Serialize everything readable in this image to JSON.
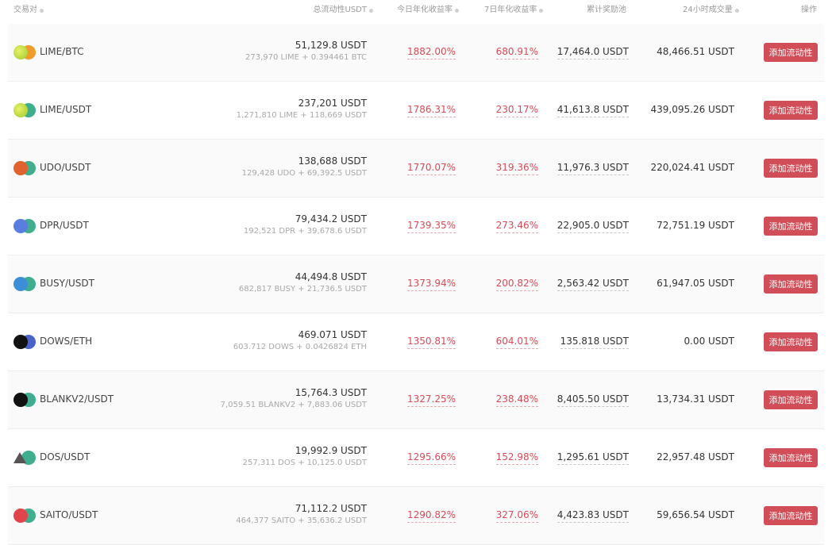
{
  "header": {
    "pair": "交易对",
    "liquidity": "总流动性USDT",
    "today_apr": "今日年化收益率",
    "apr_7d": "7日年化收益率",
    "reward_pool": "累计奖励池",
    "volume_24h": "24小时成交量",
    "action": "操作"
  },
  "colors": {
    "accent_red": "#d14d57",
    "rate_red": "#d64b57"
  },
  "rows": [
    {
      "pair": "LIME/BTC",
      "icons": [
        "lime-coin-icon",
        "btc-coin-icon"
      ],
      "liquidity": "51,129.8 USDT",
      "liquidity_detail": "273,970 LIME + 0.394461 BTC",
      "today_apr": "1882.00%",
      "apr_7d": "680.91%",
      "reward_pool": "17,464.0 USDT",
      "volume_24h": "48,466.51 USDT",
      "button": "添加流动性"
    },
    {
      "pair": "LIME/USDT",
      "icons": [
        "lime-coin-icon",
        "usdt-coin-icon"
      ],
      "liquidity": "237,201 USDT",
      "liquidity_detail": "1,271,810 LIME + 118,669 USDT",
      "today_apr": "1786.31%",
      "apr_7d": "230.17%",
      "reward_pool": "41,613.8 USDT",
      "volume_24h": "439,095.26 USDT",
      "button": "添加流动性"
    },
    {
      "pair": "UDO/USDT",
      "icons": [
        "udo-coin-icon",
        "usdt-coin-icon"
      ],
      "liquidity": "138,688 USDT",
      "liquidity_detail": "129,428 UDO + 69,392.5 USDT",
      "today_apr": "1770.07%",
      "apr_7d": "319.36%",
      "reward_pool": "11,976.3 USDT",
      "volume_24h": "220,024.41 USDT",
      "button": "添加流动性"
    },
    {
      "pair": "DPR/USDT",
      "icons": [
        "dpr-coin-icon",
        "usdt-coin-icon"
      ],
      "liquidity": "79,434.2 USDT",
      "liquidity_detail": "192,521 DPR + 39,678.6 USDT",
      "today_apr": "1739.35%",
      "apr_7d": "273.46%",
      "reward_pool": "22,905.0 USDT",
      "volume_24h": "72,751.19 USDT",
      "button": "添加流动性"
    },
    {
      "pair": "BUSY/USDT",
      "icons": [
        "busy-coin-icon",
        "usdt-coin-icon"
      ],
      "liquidity": "44,494.8 USDT",
      "liquidity_detail": "682,817 BUSY + 21,736.5 USDT",
      "today_apr": "1373.94%",
      "apr_7d": "200.82%",
      "reward_pool": "2,563.42 USDT",
      "volume_24h": "61,947.05 USDT",
      "button": "添加流动性"
    },
    {
      "pair": "DOWS/ETH",
      "icons": [
        "dows-coin-icon",
        "eth-coin-icon"
      ],
      "liquidity": "469.071 USDT",
      "liquidity_detail": "603.712 DOWS + 0.0426824 ETH",
      "today_apr": "1350.81%",
      "apr_7d": "604.01%",
      "reward_pool": "135.818 USDT",
      "volume_24h": "0.00 USDT",
      "button": "添加流动性"
    },
    {
      "pair": "BLANKV2/USDT",
      "icons": [
        "blank-coin-icon",
        "usdt-coin-icon"
      ],
      "liquidity": "15,764.3 USDT",
      "liquidity_detail": "7,059.51 BLANKV2 + 7,883.06 USDT",
      "today_apr": "1327.25%",
      "apr_7d": "238.48%",
      "reward_pool": "8,405.50 USDT",
      "volume_24h": "13,734.31 USDT",
      "button": "添加流动性"
    },
    {
      "pair": "DOS/USDT",
      "icons": [
        "dos-coin-icon",
        "usdt-coin-icon"
      ],
      "liquidity": "19,992.9 USDT",
      "liquidity_detail": "257,311 DOS + 10,125.0 USDT",
      "today_apr": "1295.66%",
      "apr_7d": "152.98%",
      "reward_pool": "1,295.61 USDT",
      "volume_24h": "22,957.48 USDT",
      "button": "添加流动性"
    },
    {
      "pair": "SAITO/USDT",
      "icons": [
        "saito-coin-icon",
        "usdt-coin-icon"
      ],
      "liquidity": "71,112.2 USDT",
      "liquidity_detail": "464,377 SAITO + 35,636.2 USDT",
      "today_apr": "1290.82%",
      "apr_7d": "327.06%",
      "reward_pool": "4,423.83 USDT",
      "volume_24h": "59,656.54 USDT",
      "button": "添加流动性"
    }
  ]
}
